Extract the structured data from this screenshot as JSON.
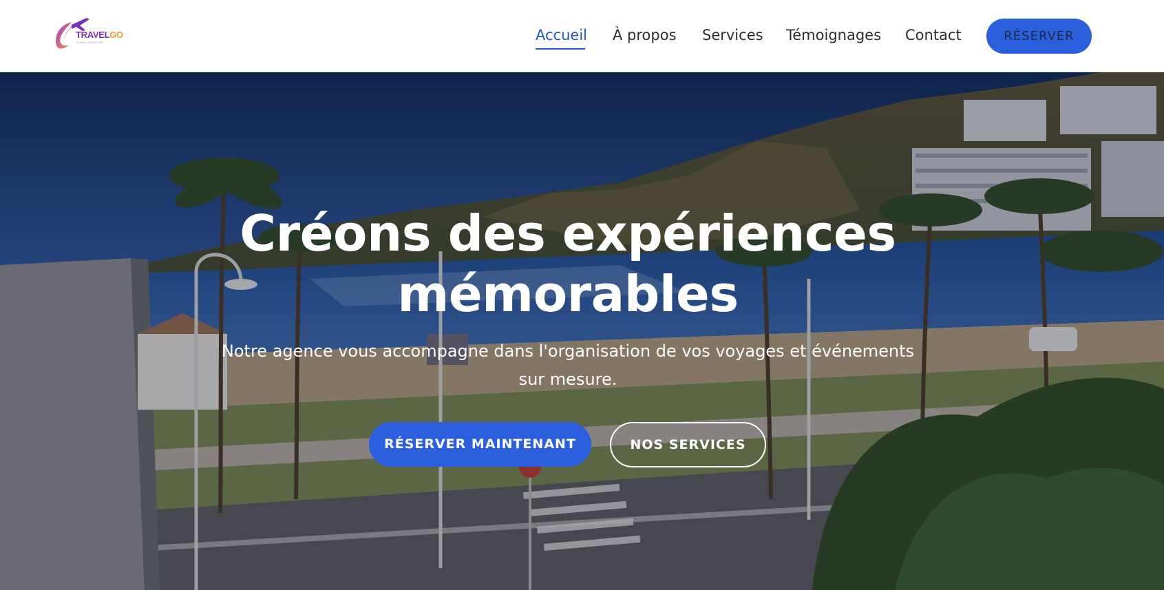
{
  "brand": {
    "name_part1": "TRAVEL",
    "name_part2": "GO",
    "tagline": "GLOBAL DEPARTURE",
    "colors": {
      "purple": "#7b2fbf",
      "orange": "#f59a3b",
      "accent_blue": "#2b5fde"
    }
  },
  "nav": {
    "items": [
      {
        "label": "Accueil",
        "active": true
      },
      {
        "label": "À propos",
        "active": false
      },
      {
        "label": "Services",
        "active": false
      },
      {
        "label": "Témoignages",
        "active": false
      },
      {
        "label": "Contact",
        "active": false
      }
    ],
    "cta_label": "RÉSERVER"
  },
  "hero": {
    "title_line1": "Créons des expériences",
    "title_line2": "mémorables",
    "subtitle": "Notre agence vous accompagne dans l'organisation de vos voyages et événements sur mesure.",
    "primary_button": "RÉSERVER MAINTENANT",
    "secondary_button": "NOS SERVICES",
    "background": "beach-promenade-photo"
  }
}
